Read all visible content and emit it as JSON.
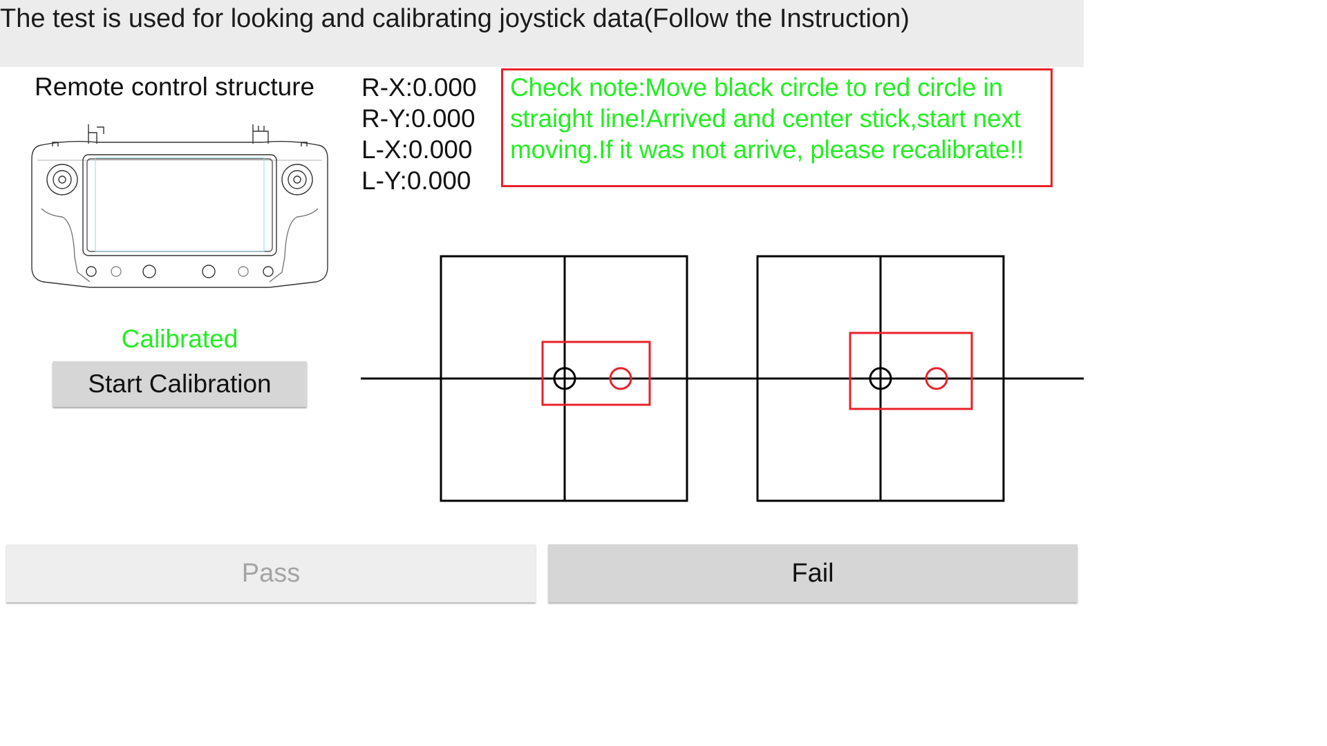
{
  "header": {
    "title": "The test is used for looking and calibrating joystick data(Follow the Instruction)"
  },
  "structure": {
    "label": "Remote control structure",
    "image_icon": "remote-controller-diagram"
  },
  "calibration": {
    "status": "Calibrated",
    "status_color": "#22ee22",
    "button_label": "Start Calibration"
  },
  "axes": {
    "rx": "R-X:0.000",
    "ry": "R-Y:0.000",
    "lx": "L-X:0.000",
    "ly": "L-Y:0.000"
  },
  "note": {
    "text": "Check note:Move black circle to red circle in straight line!Arrived and center stick,start next moving.If it was not arrive, please recalibrate!!",
    "text_color": "#22ee22",
    "border_color": "#e8202a"
  },
  "joysticks": {
    "current_marker_color": "#000000",
    "target_marker_color": "#e8202a",
    "pads": [
      {
        "name": "left-joystick-pad",
        "stick_x": 0.0,
        "stick_y": 0.0
      },
      {
        "name": "right-joystick-pad",
        "stick_x": 0.0,
        "stick_y": 0.0
      }
    ]
  },
  "footer": {
    "pass_label": "Pass",
    "fail_label": "Fail"
  }
}
